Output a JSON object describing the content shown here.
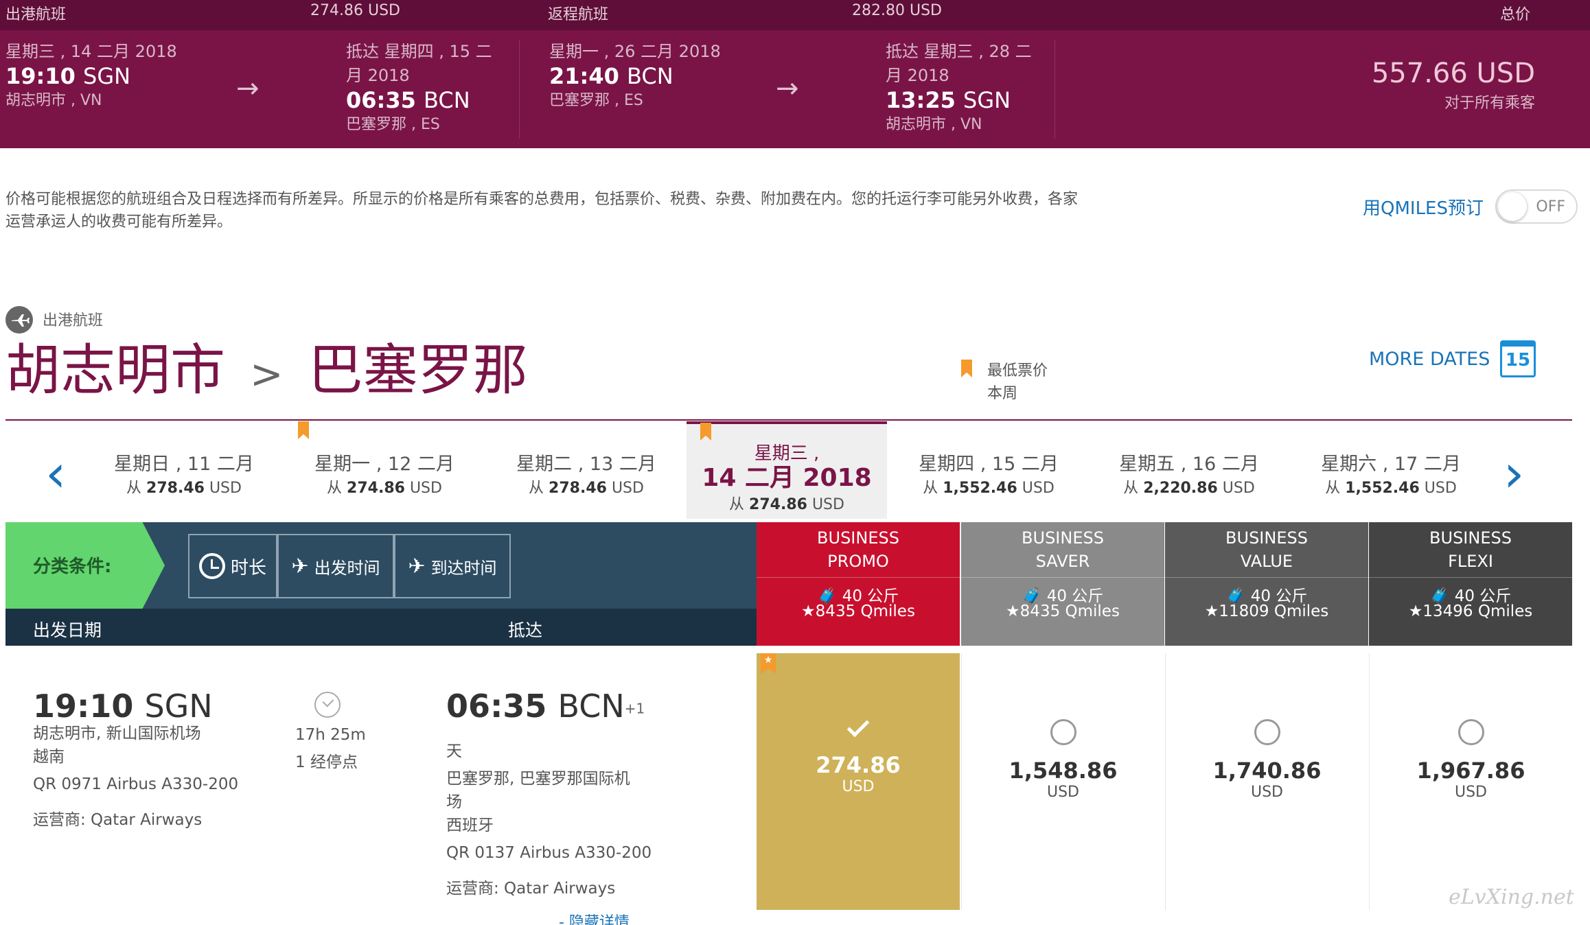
{
  "summary": {
    "outbound_label": "出港航班",
    "outbound_price": "274.86 USD",
    "return_label": "返程航班",
    "return_price": "282.80 USD",
    "total_label": "总价",
    "outbound": {
      "dep_date": "星期三 , 14 二月 2018",
      "dep_time": "19:10",
      "dep_code": "SGN",
      "dep_city": "胡志明市 , VN",
      "arr_date_1": "抵达 星期四 , 15 二",
      "arr_date_2": "月 2018",
      "arr_time": "06:35",
      "arr_code": "BCN",
      "arr_city": "巴塞罗那 , ES"
    },
    "return": {
      "dep_date": "星期一 , 26 二月 2018",
      "dep_time": "21:40",
      "dep_code": "BCN",
      "dep_city": "巴塞罗那 , ES",
      "arr_date_1": "抵达 星期三 , 28 二",
      "arr_date_2": "月 2018",
      "arr_time": "13:25",
      "arr_code": "SGN",
      "arr_city": "胡志明市 , VN"
    },
    "total_price": "557.66 USD",
    "total_note": "对于所有乘客"
  },
  "notice": {
    "line1": "价格可能根据您的航班组合及日程选择而有所差异。所显示的价格是所有乘客的总费用，包括票价、税费、杂费、附加费在内。您的托运行李可能另外收费，各家",
    "line2": "运营承运人的收费可能有所差异。",
    "qmiles_label": "用QMILES预订",
    "toggle_state": "OFF"
  },
  "route": {
    "section_label": "出港航班",
    "from": "胡志明市",
    "separator": ">",
    "to": "巴塞罗那",
    "legend_line1": "最低票价",
    "legend_line2": "本周",
    "more_dates": "MORE DATES",
    "calendar_day": "15"
  },
  "dates": [
    {
      "label": "星期日 , 11 二月",
      "prefix": "从",
      "price": "278.46",
      "currency": "USD",
      "lowest": false
    },
    {
      "label": "星期一 , 12 二月",
      "prefix": "从",
      "price": "274.86",
      "currency": "USD",
      "lowest": true
    },
    {
      "label": "星期二 , 13 二月",
      "prefix": "从",
      "price": "278.46",
      "currency": "USD",
      "lowest": false
    },
    {
      "label1": "星期三 ,",
      "label2": "14 二月 2018",
      "prefix": "从",
      "price": "274.86",
      "currency": "USD",
      "lowest": true,
      "selected": true
    },
    {
      "label": "星期四 , 15 二月",
      "prefix": "从",
      "price": "1,552.46",
      "currency": "USD",
      "lowest": false
    },
    {
      "label": "星期五 , 16 二月",
      "prefix": "从",
      "price": "2,220.86",
      "currency": "USD",
      "lowest": false
    },
    {
      "label": "星期六 , 17 二月",
      "prefix": "从",
      "price": "1,552.46",
      "currency": "USD",
      "lowest": false
    }
  ],
  "filter": {
    "label": "分类条件:",
    "duration": "时长",
    "departure": "出发时间",
    "arrival": "到达时间",
    "col_departure": "出发日期",
    "col_arrival": "抵达"
  },
  "fares": [
    {
      "name1": "BUSINESS",
      "name2": "PROMO",
      "baggage": "40 公斤",
      "qmiles": "8435 Qmiles",
      "color": "#c8102e",
      "price": "274.86",
      "currency": "USD"
    },
    {
      "name1": "BUSINESS",
      "name2": "SAVER",
      "baggage": "40 公斤",
      "qmiles": "8435 Qmiles",
      "color": "#8a8a8a",
      "price": "1,548.86",
      "currency": "USD"
    },
    {
      "name1": "BUSINESS",
      "name2": "VALUE",
      "baggage": "40 公斤",
      "qmiles": "11809 Qmiles",
      "color": "#5a5a5a",
      "price": "1,740.86",
      "currency": "USD"
    },
    {
      "name1": "BUSINESS",
      "name2": "FLEXI",
      "baggage": "40 公斤",
      "qmiles": "13496 Qmiles",
      "color": "#444444",
      "price": "1,967.86",
      "currency": "USD"
    }
  ],
  "flight": {
    "dep_time": "19:10",
    "dep_code": "SGN",
    "dep_airport": "胡志明市, 新山国际机场",
    "dep_country": "越南",
    "flight1": "QR 0971 Airbus A330-200",
    "operator1": "运营商: Qatar Airways",
    "duration": "17h 25m",
    "stops": "1 经停点",
    "arr_time": "06:35",
    "arr_code": "BCN",
    "arr_plus": "+1",
    "arr_day": "天",
    "arr_airport_1": "巴塞罗那, 巴塞罗那国际机",
    "arr_airport_2": "场",
    "arr_country": "西班牙",
    "flight2": "QR 0137 Airbus A330-200",
    "operator2": "运营商: Qatar Airways",
    "hide_details": "- 隐藏详情"
  },
  "watermark": "eLvXing.net",
  "colors": {
    "brand": "#7a1447",
    "header_dark": "#5e0e38",
    "link": "#1a73b8",
    "filter_green": "#62d56e",
    "filter_bg": "#2d4c62",
    "selected_fare": "#cfb159"
  }
}
